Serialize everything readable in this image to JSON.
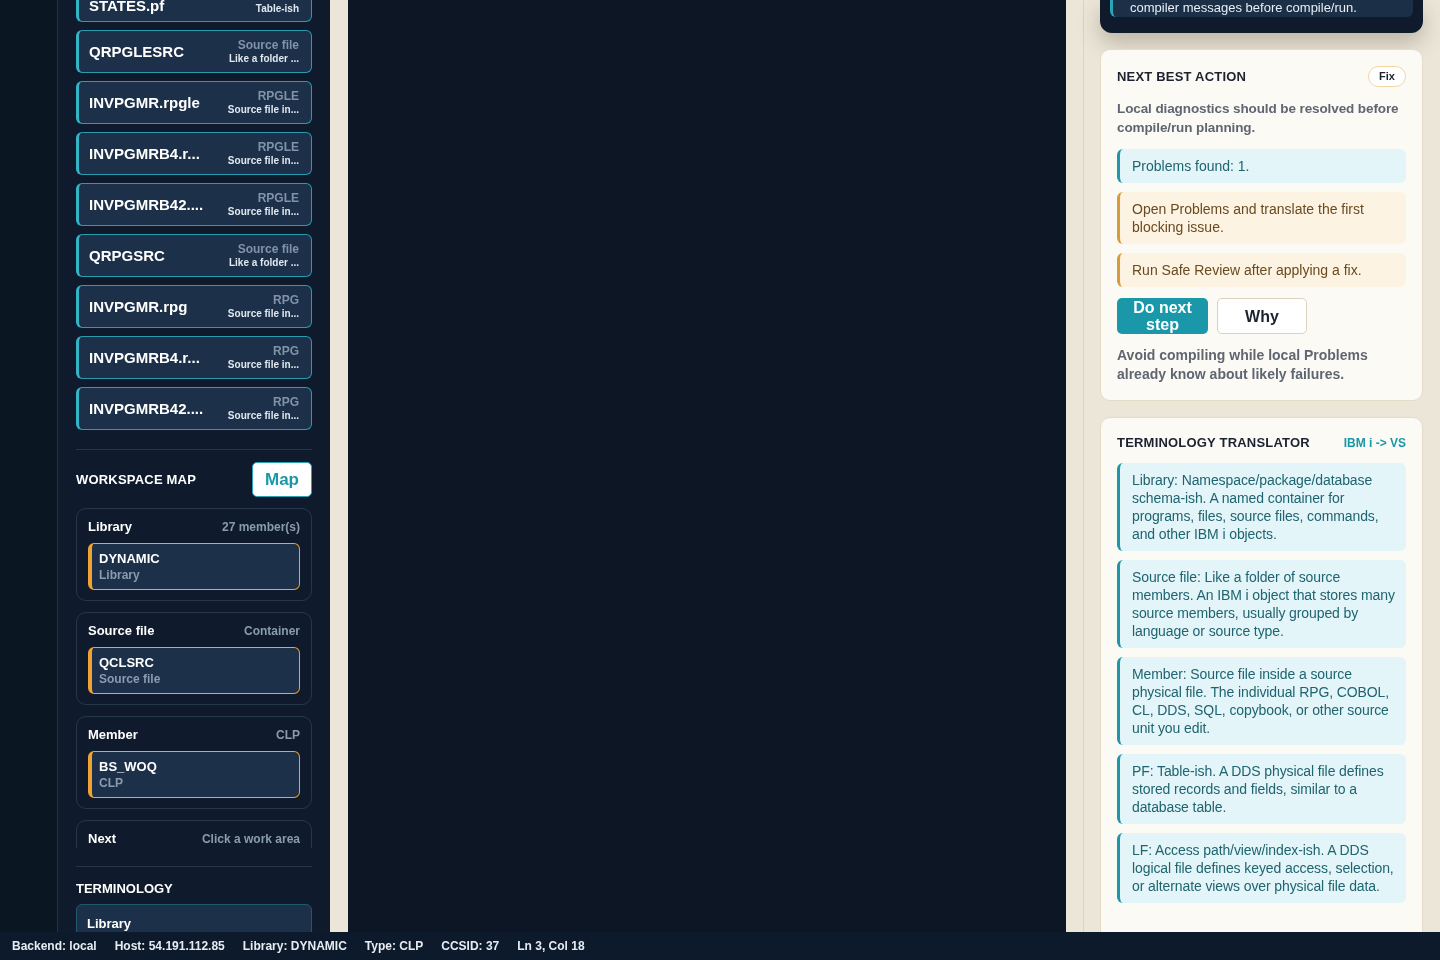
{
  "sidebar": {
    "objects": [
      {
        "name": "STATES.pf",
        "description": "Table-ish"
      },
      {
        "name": "QRPGLESRC",
        "type": "Source file",
        "description": "Like a folder ..."
      },
      {
        "name": "INVPGMR.rpgle",
        "type": "RPGLE",
        "description": "Source file in..."
      },
      {
        "name": "INVPGMRB4.r...",
        "type": "RPGLE",
        "description": "Source file in..."
      },
      {
        "name": "INVPGMRB42....",
        "type": "RPGLE",
        "description": "Source file in..."
      },
      {
        "name": "QRPGSRC",
        "type": "Source file",
        "description": "Like a folder ..."
      },
      {
        "name": "INVPGMR.rpg",
        "type": "RPG",
        "description": "Source file in..."
      },
      {
        "name": "INVPGMRB4.r...",
        "type": "RPG",
        "description": "Source file in..."
      },
      {
        "name": "INVPGMRB42....",
        "type": "RPG",
        "description": "Source file in..."
      }
    ],
    "workspace_map": {
      "title": "WORKSPACE MAP",
      "map_button": "Map",
      "groups": [
        {
          "label": "Library",
          "meta": "27 member(s)",
          "node": {
            "name": "DYNAMIC",
            "type": "Library"
          }
        },
        {
          "label": "Source file",
          "meta": "Container",
          "node": {
            "name": "QCLSRC",
            "type": "Source file"
          }
        },
        {
          "label": "Member",
          "meta": "CLP",
          "node": {
            "name": "BS_WOQ",
            "type": "CLP"
          }
        },
        {
          "label": "Next",
          "meta": "Click a work area"
        }
      ]
    },
    "terminology": {
      "title": "TERMINOLOGY",
      "items": [
        {
          "term": "Library"
        }
      ]
    }
  },
  "right_panel": {
    "diagnostics_card": {
      "text": "compiler messages before compile/run."
    },
    "next_best_action": {
      "title": "NEXT BEST ACTION",
      "badge": "Fix",
      "summary": "Local diagnostics should be resolved before compile/run planning.",
      "steps": [
        {
          "kind": "info",
          "text": "Problems found: 1."
        },
        {
          "kind": "warning",
          "text": "Open Problems and translate the first blocking issue."
        },
        {
          "kind": "warning",
          "text": "Run Safe Review after applying a fix."
        }
      ],
      "buttons": [
        {
          "kind": "primary",
          "label": "Do next step"
        },
        {
          "kind": "secondary",
          "label": "Why"
        }
      ],
      "note": "Avoid compiling while local Problems already know about likely failures."
    },
    "terminology_translator": {
      "title": "TERMINOLOGY TRANSLATOR",
      "direction": "IBM i -> VS",
      "entries": [
        "Library: Namespace/package/database schema-ish. A named container for programs, files, source files, commands, and other IBM i objects.",
        "Source file: Like a folder of source members. An IBM i object that stores many source members, usually grouped by language or source type.",
        "Member: Source file inside a source physical file. The individual RPG, COBOL, CL, DDS, SQL, copybook, or other source unit you edit.",
        "PF: Table-ish. A DDS physical file defines stored records and fields, similar to a database table.",
        "LF: Access path/view/index-ish. A DDS logical file defines keyed access, selection, or alternate views over physical file data."
      ]
    }
  },
  "status_bar": {
    "items": [
      "Backend: local",
      "Host: 54.191.112.85",
      "Library: DYNAMIC",
      "Type: CLP",
      "CCSID: 37",
      "Ln 3, Col 18"
    ]
  }
}
